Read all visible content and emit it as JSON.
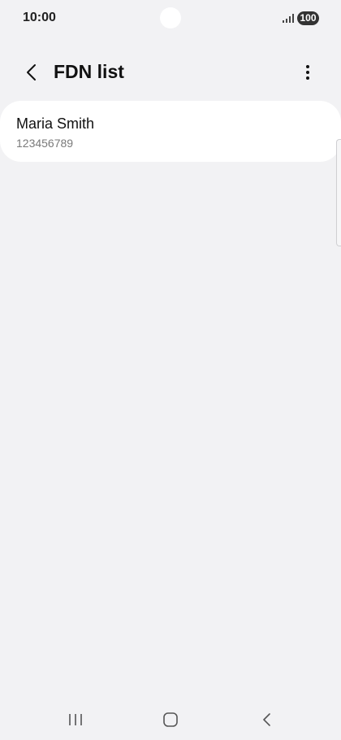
{
  "status_bar": {
    "time": "10:00",
    "battery": "100",
    "signal_icon": "signal-icon",
    "battery_icon": "battery-icon"
  },
  "app_bar": {
    "title": "FDN list",
    "back_icon": "chevron-left-icon",
    "more_icon": "more-vertical-icon"
  },
  "fdn_list": {
    "items": [
      {
        "name": "Maria Smith",
        "number": "123456789"
      }
    ]
  },
  "nav_bar": {
    "recents_icon": "recents-icon",
    "home_icon": "home-icon",
    "back_icon": "back-icon"
  },
  "colors": {
    "background": "#f2f2f4",
    "card": "#ffffff",
    "primary_text": "#111111",
    "secondary_text": "#7a7a7a"
  }
}
